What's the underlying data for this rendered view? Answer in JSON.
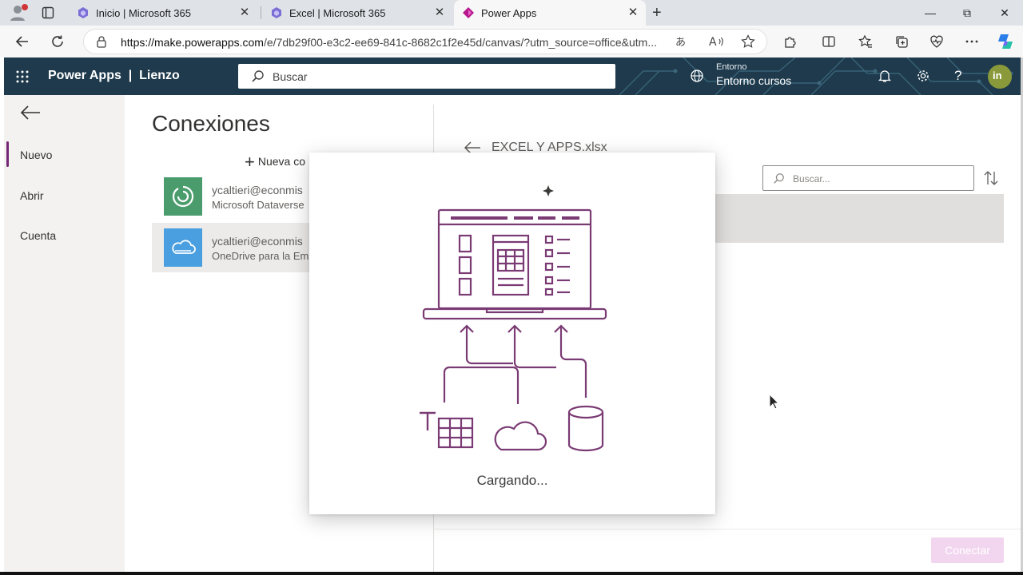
{
  "browser": {
    "tabs": [
      {
        "label": "Inicio | Microsoft 365",
        "close": "✕"
      },
      {
        "label": "Excel | Microsoft 365",
        "close": "✕"
      },
      {
        "label": "Power Apps",
        "close": "✕"
      }
    ],
    "active_tab": 2,
    "new_tab": "+",
    "window_controls": {
      "minimize": "—",
      "restore": "⧉",
      "close": "✕"
    },
    "url_host": "https://make.powerapps.com",
    "url_path": "/e/7db29f00-e3c2-ee69-841c-8682c1f2e45d/canvas/?utm_source=office&utm...",
    "icons": [
      "back-icon",
      "refresh-icon",
      "lock-icon",
      "translate-icon",
      "read-aloud-icon",
      "favorite-star-icon",
      "extensions-icon",
      "split-screen-icon",
      "favorites-icon",
      "collections-icon",
      "performance-icon",
      "more-icon",
      "copilot-icon"
    ]
  },
  "header": {
    "brand": "Power Apps  |  Lienzo",
    "search_placeholder": "Buscar",
    "env_label": "Entorno",
    "env_value": "Entorno cursos",
    "avatar_text": "in",
    "colors": {
      "bar": "#1e3a4c",
      "accent": "#742774"
    }
  },
  "leftnav": {
    "items": [
      {
        "label": "Nuevo",
        "selected": true
      },
      {
        "label": "Abrir",
        "selected": false
      },
      {
        "label": "Cuenta",
        "selected": false
      }
    ]
  },
  "connections": {
    "title": "Conexiones",
    "new_button": "Nueva co",
    "items": [
      {
        "line1": "ycaltieri@econmis",
        "line2": "Microsoft Dataverse",
        "color": "#4a9c6d"
      },
      {
        "line1": "ycaltieri@econmis",
        "line2": "OneDrive para la Emp",
        "color": "#4a9fe0"
      }
    ]
  },
  "right_panel": {
    "file_title": "EXCEL Y APPS.xlsx",
    "search_placeholder": "Buscar...",
    "connect_button": "Conectar"
  },
  "loading": {
    "text": "Cargando...",
    "illustration_color": "#7a3b74"
  }
}
